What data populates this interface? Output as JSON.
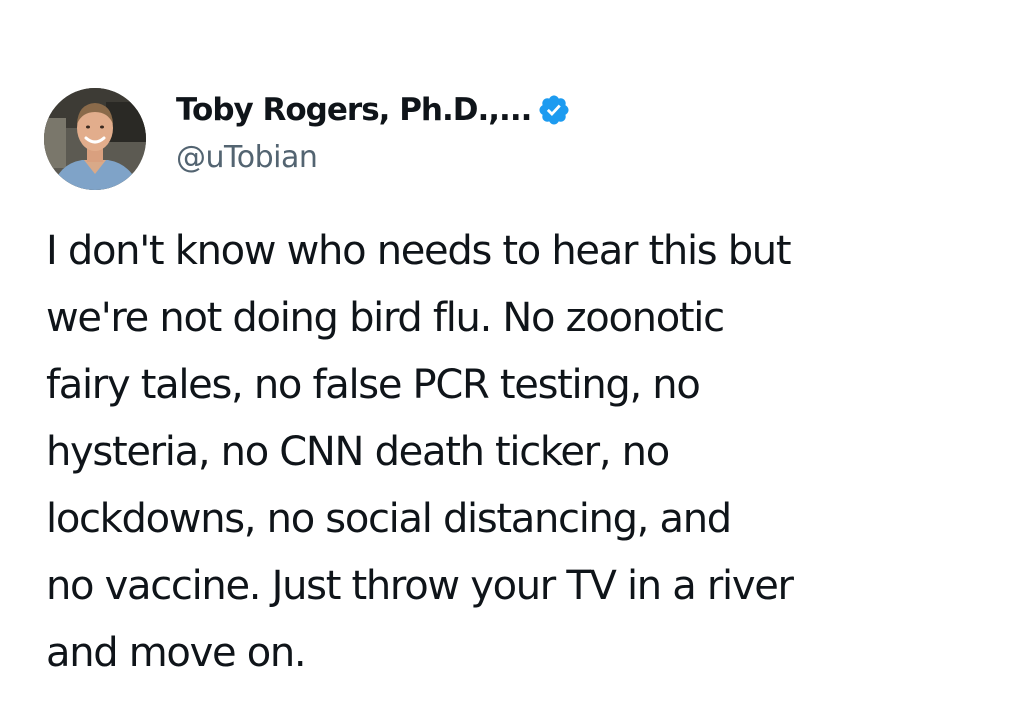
{
  "author": {
    "display_name": "Toby Rogers, Ph.D.,...",
    "handle": "@uTobian",
    "verified": true,
    "verified_badge_color": "#1d9bf0",
    "avatar_icon": "profile-photo"
  },
  "tweet": {
    "lines": [
      "I don't know who needs to hear this but",
      "we're not doing bird flu. No zoonotic",
      "fairy tales, no false PCR testing, no",
      "hysteria, no CNN death ticker, no",
      "lockdowns, no social distancing, and",
      "no vaccine. Just throw your TV in a river",
      "and move on."
    ]
  },
  "colors": {
    "text_primary": "#0f1419",
    "text_secondary": "#536471",
    "background": "#ffffff"
  }
}
